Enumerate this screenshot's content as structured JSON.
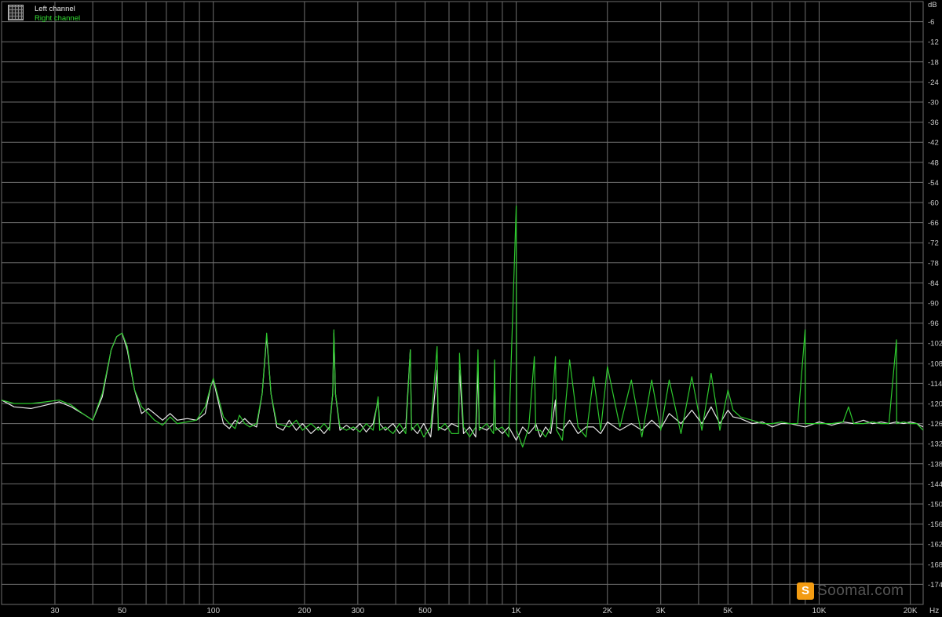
{
  "legend": {
    "left_channel": "Left channel",
    "right_channel": "Right channel"
  },
  "watermark": {
    "logo_glyph": "S",
    "text": "Soomal.com"
  },
  "colors": {
    "background": "#000000",
    "grid": "#6e6e6e",
    "axis_text": "#cccccc",
    "left_channel": "#e8e8e8",
    "right_channel": "#2ec82e"
  },
  "chart_data": {
    "type": "line",
    "title": "",
    "x_scale": "log",
    "xlim": [
      20,
      22050
    ],
    "ylim": [
      0,
      -180
    ],
    "xunit": "Hz",
    "yunit": "dB",
    "grid": true,
    "legend_position": "top-left",
    "x_ticks": [
      {
        "value": 30,
        "label": "30"
      },
      {
        "value": 50,
        "label": "50"
      },
      {
        "value": 100,
        "label": "100"
      },
      {
        "value": 200,
        "label": "200"
      },
      {
        "value": 300,
        "label": "300"
      },
      {
        "value": 500,
        "label": "500"
      },
      {
        "value": 1000,
        "label": "1K"
      },
      {
        "value": 2000,
        "label": "2K"
      },
      {
        "value": 3000,
        "label": "3K"
      },
      {
        "value": 5000,
        "label": "5K"
      },
      {
        "value": 10000,
        "label": "10K"
      },
      {
        "value": 20000,
        "label": "20K"
      }
    ],
    "y_ticks": [
      -6,
      -12,
      -18,
      -24,
      -30,
      -36,
      -42,
      -48,
      -54,
      -60,
      -66,
      -72,
      -78,
      -84,
      -90,
      -96,
      -102,
      -108,
      -114,
      -120,
      -126,
      -132,
      -138,
      -144,
      -150,
      -156,
      -162,
      -168,
      -174
    ],
    "series": [
      {
        "name": "Left channel",
        "points": [
          [
            20,
            -119
          ],
          [
            22,
            -121
          ],
          [
            25,
            -121.5
          ],
          [
            28,
            -120.5
          ],
          [
            31,
            -119.5
          ],
          [
            34,
            -121
          ],
          [
            37,
            -123
          ],
          [
            40,
            -125
          ],
          [
            43,
            -118
          ],
          [
            46,
            -104
          ],
          [
            48,
            -100
          ],
          [
            50,
            -99
          ],
          [
            52,
            -104
          ],
          [
            55,
            -116
          ],
          [
            58,
            -123
          ],
          [
            61,
            -121.5
          ],
          [
            64,
            -123
          ],
          [
            68,
            -125
          ],
          [
            72,
            -123
          ],
          [
            76,
            -125
          ],
          [
            82,
            -124.5
          ],
          [
            88,
            -125
          ],
          [
            94,
            -123
          ],
          [
            98,
            -115
          ],
          [
            100,
            -113
          ],
          [
            103,
            -118
          ],
          [
            108,
            -126
          ],
          [
            113,
            -127.5
          ],
          [
            118,
            -125
          ],
          [
            122,
            -126
          ],
          [
            127,
            -124.5
          ],
          [
            132,
            -126
          ],
          [
            139,
            -127
          ],
          [
            145,
            -117
          ],
          [
            150,
            -100
          ],
          [
            155,
            -117
          ],
          [
            162,
            -127
          ],
          [
            170,
            -128
          ],
          [
            178,
            -125
          ],
          [
            188,
            -128
          ],
          [
            197,
            -126
          ],
          [
            210,
            -129
          ],
          [
            222,
            -127
          ],
          [
            232,
            -129
          ],
          [
            242,
            -127
          ],
          [
            248,
            -117
          ],
          [
            250,
            -99
          ],
          [
            253,
            -117
          ],
          [
            262,
            -128
          ],
          [
            275,
            -126.5
          ],
          [
            290,
            -128
          ],
          [
            305,
            -126
          ],
          [
            320,
            -128.5
          ],
          [
            337,
            -126
          ],
          [
            350,
            -119
          ],
          [
            354,
            -126
          ],
          [
            370,
            -128
          ],
          [
            392,
            -126
          ],
          [
            412,
            -129
          ],
          [
            432,
            -127
          ],
          [
            447,
            -104
          ],
          [
            451,
            -127
          ],
          [
            472,
            -129
          ],
          [
            495,
            -126
          ],
          [
            522,
            -130
          ],
          [
            548,
            -110
          ],
          [
            553,
            -127
          ],
          [
            582,
            -128
          ],
          [
            612,
            -126
          ],
          [
            645,
            -127
          ],
          [
            650,
            -110
          ],
          [
            670,
            -129
          ],
          [
            702,
            -127
          ],
          [
            735,
            -130
          ],
          [
            748,
            -110
          ],
          [
            755,
            -127
          ],
          [
            800,
            -128
          ],
          [
            842,
            -126
          ],
          [
            848,
            -110
          ],
          [
            855,
            -127
          ],
          [
            900,
            -129
          ],
          [
            945,
            -127
          ],
          [
            1000,
            -131
          ],
          [
            1050,
            -127
          ],
          [
            1100,
            -129
          ],
          [
            1148,
            -127
          ],
          [
            1160,
            -126
          ],
          [
            1200,
            -130
          ],
          [
            1250,
            -127
          ],
          [
            1300,
            -129
          ],
          [
            1348,
            -119
          ],
          [
            1360,
            -127
          ],
          [
            1420,
            -128
          ],
          [
            1500,
            -125
          ],
          [
            1600,
            -129
          ],
          [
            1700,
            -127
          ],
          [
            1800,
            -127
          ],
          [
            1900,
            -129
          ],
          [
            2000,
            -125.5
          ],
          [
            2200,
            -128
          ],
          [
            2400,
            -126
          ],
          [
            2600,
            -128
          ],
          [
            2800,
            -125
          ],
          [
            3000,
            -127.5
          ],
          [
            3200,
            -123
          ],
          [
            3500,
            -126
          ],
          [
            3800,
            -122
          ],
          [
            4100,
            -126
          ],
          [
            4400,
            -121
          ],
          [
            4700,
            -126
          ],
          [
            5000,
            -122
          ],
          [
            5200,
            -124
          ],
          [
            5500,
            -124.5
          ],
          [
            6000,
            -126
          ],
          [
            6500,
            -125.5
          ],
          [
            7000,
            -127
          ],
          [
            7500,
            -126
          ],
          [
            8000,
            -126
          ],
          [
            9000,
            -127
          ],
          [
            10000,
            -125.5
          ],
          [
            11000,
            -126.5
          ],
          [
            12000,
            -125.5
          ],
          [
            13000,
            -126
          ],
          [
            14000,
            -125
          ],
          [
            15000,
            -126
          ],
          [
            16000,
            -125.5
          ],
          [
            17000,
            -126
          ],
          [
            18000,
            -125.5
          ],
          [
            19000,
            -126
          ],
          [
            20000,
            -125.5
          ],
          [
            21000,
            -126
          ],
          [
            22050,
            -127
          ]
        ]
      },
      {
        "name": "Right channel",
        "points": [
          [
            20,
            -119
          ],
          [
            22,
            -120
          ],
          [
            25,
            -120
          ],
          [
            28,
            -119.5
          ],
          [
            31,
            -119
          ],
          [
            34,
            -120.5
          ],
          [
            37,
            -123
          ],
          [
            40,
            -125
          ],
          [
            43,
            -117
          ],
          [
            46,
            -104
          ],
          [
            48,
            -100
          ],
          [
            50,
            -99
          ],
          [
            52,
            -103
          ],
          [
            55,
            -116
          ],
          [
            58,
            -121
          ],
          [
            61,
            -123
          ],
          [
            64,
            -125
          ],
          [
            68,
            -126.5
          ],
          [
            72,
            -124
          ],
          [
            76,
            -126
          ],
          [
            82,
            -125.5
          ],
          [
            88,
            -125
          ],
          [
            94,
            -121
          ],
          [
            98,
            -115
          ],
          [
            100,
            -112.5
          ],
          [
            103,
            -117
          ],
          [
            108,
            -124
          ],
          [
            113,
            -126
          ],
          [
            118,
            -127.5
          ],
          [
            122,
            -123.5
          ],
          [
            127,
            -126
          ],
          [
            132,
            -127
          ],
          [
            139,
            -126
          ],
          [
            145,
            -117
          ],
          [
            150,
            -99
          ],
          [
            155,
            -117
          ],
          [
            162,
            -126
          ],
          [
            170,
            -126.5
          ],
          [
            178,
            -127
          ],
          [
            188,
            -125
          ],
          [
            197,
            -128
          ],
          [
            210,
            -126
          ],
          [
            222,
            -128
          ],
          [
            232,
            -126
          ],
          [
            242,
            -128
          ],
          [
            248,
            -117
          ],
          [
            250,
            -98
          ],
          [
            253,
            -117
          ],
          [
            262,
            -127
          ],
          [
            275,
            -128
          ],
          [
            290,
            -127
          ],
          [
            305,
            -128.5
          ],
          [
            320,
            -126
          ],
          [
            337,
            -128
          ],
          [
            350,
            -118
          ],
          [
            354,
            -128
          ],
          [
            370,
            -127
          ],
          [
            392,
            -129
          ],
          [
            412,
            -126
          ],
          [
            432,
            -129
          ],
          [
            447,
            -104
          ],
          [
            451,
            -128
          ],
          [
            472,
            -126
          ],
          [
            495,
            -130
          ],
          [
            522,
            -127
          ],
          [
            548,
            -103
          ],
          [
            553,
            -128
          ],
          [
            582,
            -126
          ],
          [
            612,
            -129
          ],
          [
            645,
            -129
          ],
          [
            650,
            -105
          ],
          [
            670,
            -127
          ],
          [
            702,
            -130
          ],
          [
            735,
            -127
          ],
          [
            748,
            -104
          ],
          [
            755,
            -128
          ],
          [
            800,
            -126
          ],
          [
            842,
            -129
          ],
          [
            848,
            -107
          ],
          [
            855,
            -128
          ],
          [
            900,
            -127
          ],
          [
            945,
            -130
          ],
          [
            1000,
            -61
          ],
          [
            1003,
            -128
          ],
          [
            1050,
            -133
          ],
          [
            1100,
            -127
          ],
          [
            1148,
            -106
          ],
          [
            1160,
            -128
          ],
          [
            1200,
            -128
          ],
          [
            1250,
            -130
          ],
          [
            1300,
            -127
          ],
          [
            1348,
            -106
          ],
          [
            1360,
            -128
          ],
          [
            1420,
            -131
          ],
          [
            1500,
            -107
          ],
          [
            1600,
            -127
          ],
          [
            1700,
            -130
          ],
          [
            1800,
            -112
          ],
          [
            1900,
            -128
          ],
          [
            2000,
            -109
          ],
          [
            2200,
            -127
          ],
          [
            2400,
            -113
          ],
          [
            2600,
            -130
          ],
          [
            2800,
            -113
          ],
          [
            3000,
            -128
          ],
          [
            3200,
            -113
          ],
          [
            3500,
            -129
          ],
          [
            3800,
            -112
          ],
          [
            4100,
            -128
          ],
          [
            4400,
            -111
          ],
          [
            4700,
            -128
          ],
          [
            5000,
            -116
          ],
          [
            5200,
            -122
          ],
          [
            5500,
            -124
          ],
          [
            6000,
            -125
          ],
          [
            6500,
            -126
          ],
          [
            7000,
            -126
          ],
          [
            7500,
            -125.5
          ],
          [
            8000,
            -126
          ],
          [
            8500,
            -126
          ],
          [
            8990,
            -98
          ],
          [
            9010,
            -126
          ],
          [
            9500,
            -126
          ],
          [
            10000,
            -126
          ],
          [
            11000,
            -126
          ],
          [
            12000,
            -125.5
          ],
          [
            12500,
            -121
          ],
          [
            13000,
            -126
          ],
          [
            14000,
            -126
          ],
          [
            15000,
            -125.5
          ],
          [
            16000,
            -126
          ],
          [
            17000,
            -126
          ],
          [
            18000,
            -101
          ],
          [
            18030,
            -126
          ],
          [
            19000,
            -125.5
          ],
          [
            20000,
            -126
          ],
          [
            21000,
            -126
          ],
          [
            22050,
            -128
          ]
        ]
      }
    ]
  }
}
